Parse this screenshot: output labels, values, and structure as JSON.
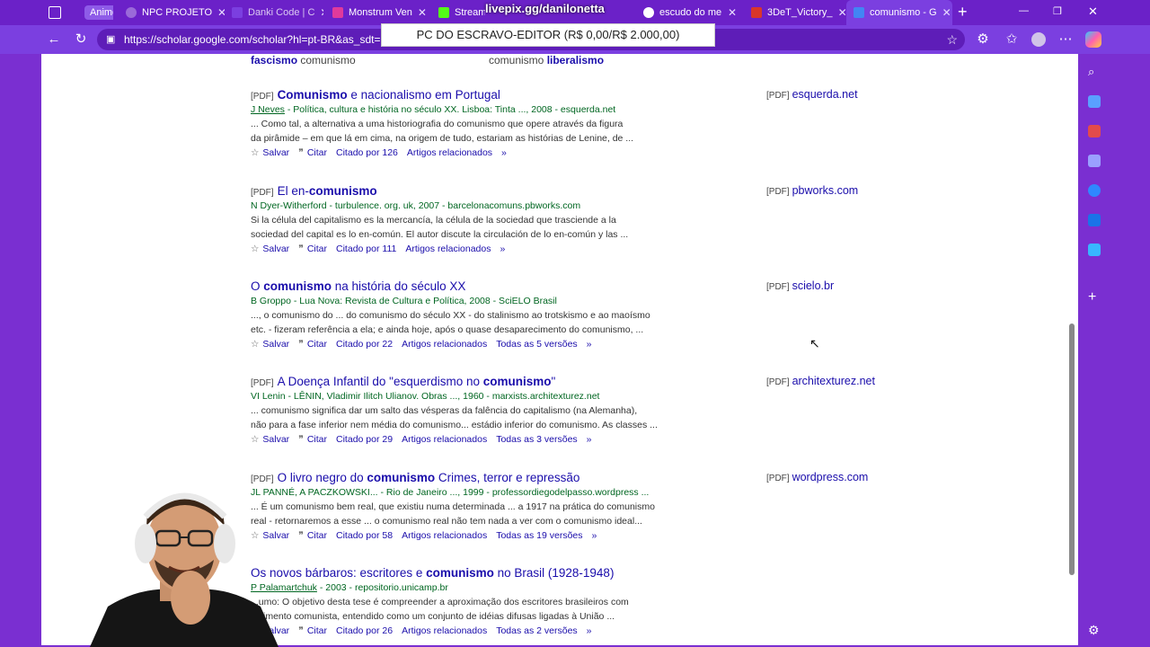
{
  "tabs": [
    {
      "label": "Anime",
      "fav": "#8e5be8",
      "close": ""
    },
    {
      "label": "NPC PROJETO",
      "fav": "#9a6ad9",
      "close": "✕"
    },
    {
      "label": "Danki Code | C",
      "fav": "#7b3fe0",
      "close": "✕"
    },
    {
      "label": "Monstrum Ven",
      "fav": "#e03a9c",
      "close": "✕"
    },
    {
      "label": "Stream",
      "fav": "#53fc18",
      "close": "✕"
    },
    {
      "label": "escudo do me",
      "fav": "#4285f4",
      "close": "✕"
    },
    {
      "label": "3DeT_Victory_",
      "fav": "#d9362b",
      "close": "✕"
    },
    {
      "label": "comunismo - G",
      "fav": "#4285f4",
      "close": "✕"
    }
  ],
  "window_controls": {
    "new_tab": "+",
    "minimize": "—",
    "restore": "❐",
    "close": "✕"
  },
  "address": {
    "url": "https://scholar.google.com/scholar?hl=pt-BR&as_sdt=0"
  },
  "overlays": {
    "title": "livepix.gg/danilonetta",
    "box": "PC DO ESCRAVO-EDITOR (R$ 0,00/R$ 2.000,00)"
  },
  "prev": [
    {
      "bold": "fascismo",
      "rest": " comunismo"
    },
    {
      "plain": "comunismo ",
      "bold": "liberalismo"
    }
  ],
  "results": [
    {
      "pdf": "[PDF]",
      "title_pre": "",
      "title_bold": "Comunismo",
      "title_post": " e nacionalismo em Portugal",
      "meta_link": "J Neves",
      "meta_rest": " - Política, cultura e história no século XX. Lisboa: Tinta ..., 2008 - esquerda.net",
      "snip1": "... Como tal, a alternativa a uma historiografia do comunismo que opere através da figura",
      "snip2": "da pirâmide – em que lá em cima, na origem de tudo, estariam as histórias de Lenine, de ...",
      "cited": "Citado por 126",
      "versions": "",
      "side": "esquerda.net"
    },
    {
      "pdf": "[PDF]",
      "title_pre": "El en-",
      "title_bold": "comunismo",
      "title_post": "",
      "meta_link": "",
      "meta_rest": "N Dyer-Witherford - turbulence. org. uk, 2007 - barcelonacomuns.pbworks.com",
      "snip1": "Si la célula del capitalismo es la mercancía, la célula de la sociedad que trasciende a la",
      "snip2": "sociedad del capital es lo en-común. El autor discute la circulación de lo en-común y las ...",
      "cited": "Citado por 111",
      "versions": "",
      "side": "pbworks.com"
    },
    {
      "pdf": "",
      "title_pre": "O ",
      "title_bold": "comunismo",
      "title_post": " na história do século XX",
      "meta_link": "",
      "meta_rest": "B Groppo - Lua Nova: Revista de Cultura e Política, 2008 - SciELO Brasil",
      "snip1": "..., o comunismo do ... do comunismo do século XX - do stalinismo ao trotskismo e ao maoísmo",
      "snip2": "etc. - fizeram referência a ela; e ainda hoje, após o quase desaparecimento do comunismo, ...",
      "cited": "Citado por 22",
      "versions": "Todas as 5 versões",
      "side": "scielo.br"
    },
    {
      "pdf": "[PDF]",
      "title_pre": "A Doença Infantil do \"esquerdismo no ",
      "title_bold": "comunismo",
      "title_post": "\"",
      "meta_link": "",
      "meta_rest": "VI Lenin - LÊNIN, Vladimir Ilitch Ulianov. Obras ..., 1960 - marxists.architexturez.net",
      "snip1": "... comunismo significa dar um salto das vésperas da falência do capitalismo (na Alemanha),",
      "snip2": "não para a fase inferior nem média do comunismo... estádio inferior do comunismo. As classes ...",
      "cited": "Citado por 29",
      "versions": "Todas as 3 versões",
      "side": "architexturez.net"
    },
    {
      "pdf": "[PDF]",
      "title_pre": "O livro negro do ",
      "title_bold": "comunismo",
      "title_post": " Crimes, terror e repressão",
      "meta_link": "",
      "meta_rest": "JL PANNÉ, A PACZKOWSKI... - Rio de Janeiro ..., 1999 - professordiegodelpasso.wordpress ...",
      "snip1": "... É um comunismo bem real, que existiu numa determinada ... a 1917 na prática do comunismo",
      "snip2": "real - retornaremos a esse ... o comunismo real não tem nada a ver com o comunismo ideal...",
      "cited": "Citado por 58",
      "versions": "Todas as 19 versões",
      "side": "wordpress.com"
    },
    {
      "pdf": "",
      "title_pre": "Os novos bárbaros: escritores e ",
      "title_bold": "comunismo",
      "title_post": " no Brasil (1928-1948)",
      "meta_link": "P Palamartchuk",
      "meta_rest": " - 2003 - repositorio.unicamp.br",
      "snip1": "...umo: O objetivo desta tese é compreender a aproximação dos escritores brasileiros com",
      "snip2": "...vimento comunista, entendido como um conjunto de idéias difusas ligadas à União ...",
      "cited": "Citado por 26",
      "versions": "Todas as 2 versões",
      "side": ""
    }
  ],
  "actions": {
    "save": "Salvar",
    "cite": "Citar",
    "related": "Artigos relacionados",
    "more": "»"
  },
  "colors": {
    "accent": "#7b3fe0",
    "link": "#1a0dab",
    "meta": "#006621"
  }
}
